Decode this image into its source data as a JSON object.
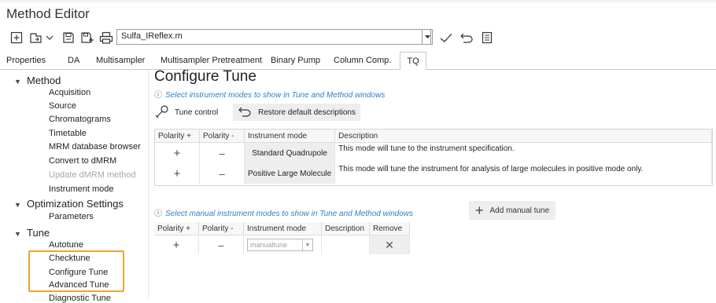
{
  "window": {
    "title": "Method Editor"
  },
  "toolbar": {
    "method_file": "Sulfa_IReflex.m",
    "icons": [
      "new-method-icon",
      "open-method-icon",
      "save-icon",
      "save-as-icon",
      "print-icon",
      "dropdown-icon",
      "check-icon",
      "undo-icon",
      "report-icon"
    ]
  },
  "tabs": [
    {
      "label": "Properties"
    },
    {
      "label": "DA"
    },
    {
      "label": "Multisampler"
    },
    {
      "label": "Multisampler Pretreatment"
    },
    {
      "label": "Binary Pump"
    },
    {
      "label": "Column Comp."
    },
    {
      "label": "TQ",
      "active": true
    }
  ],
  "tree": {
    "method": {
      "label": "Method",
      "items": [
        "Acquisition",
        "Source",
        "Chromatograms",
        "Timetable",
        "MRM database browser",
        "Convert to dMRM",
        "Update dMRM method",
        "Instrument mode"
      ]
    },
    "optimization": {
      "label": "Optimization Settings",
      "items": [
        "Parameters"
      ]
    },
    "tune": {
      "label": "Tune",
      "items": [
        "Autotune",
        "Checktune",
        "Configure Tune",
        "Advanced Tune",
        "Diagnostic Tune"
      ]
    }
  },
  "main": {
    "title": "Configure Tune",
    "instrument_hint": "Select instrument modes to show in Tune and Method windows",
    "tune_control_label": "Tune control",
    "restore_label": "Restore default descriptions",
    "grid1": {
      "headers": [
        "Polarity +",
        "Polarity -",
        "Instrument mode",
        "Description"
      ],
      "rows": [
        {
          "plus": "+",
          "minus": "–",
          "mode": "Standard Quadrupole",
          "description": "This mode will tune to the instrument specification."
        },
        {
          "plus": "+",
          "minus": "–",
          "mode": "Positive Large Molecule",
          "description": "This mode will tune the instrument for analysis of large molecules in positive mode only."
        }
      ]
    },
    "manual_hint": "Select manual instrument modes to show in Tune and Method windows",
    "add_manual_label": "Add manual tune",
    "grid2": {
      "headers": [
        "Polarity +",
        "Polarity -",
        "Instrument mode",
        "Description",
        "Remove"
      ],
      "rows": [
        {
          "plus": "+",
          "minus": "–",
          "mode": "manualtune",
          "description": "",
          "remove": "✕"
        }
      ]
    }
  }
}
